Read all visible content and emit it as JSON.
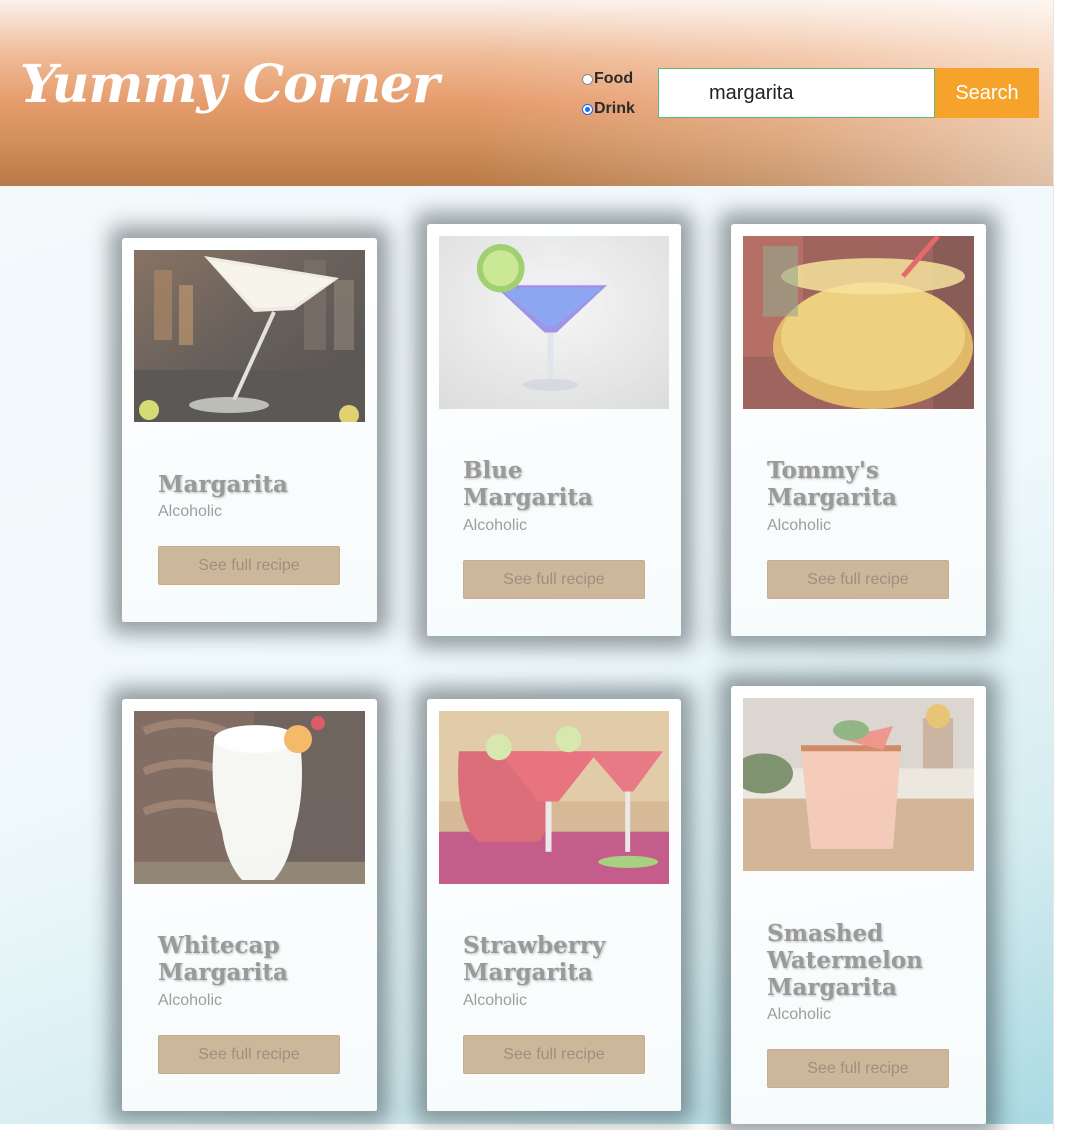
{
  "brand": {
    "logo_text": "Yummy Corner"
  },
  "search": {
    "options": [
      {
        "label": "Food",
        "selected": false
      },
      {
        "label": "Drink",
        "selected": true
      }
    ],
    "query": "margarita",
    "button_label": "Search"
  },
  "colors": {
    "accent": "#f5a32a",
    "card_button": "#cdb79a",
    "header_gradient_top": "#fbf2ec",
    "header_gradient_bottom": "#b87a47"
  },
  "results": [
    {
      "title": "Margarita",
      "category": "Alcoholic",
      "button_label": "See full recipe",
      "image": "margarita-glass-photo"
    },
    {
      "title": "Blue Margarita",
      "category": "Alcoholic",
      "button_label": "See full recipe",
      "image": "blue-margarita-photo"
    },
    {
      "title": "Tommy's Margarita",
      "category": "Alcoholic",
      "button_label": "See full recipe",
      "image": "tommys-margarita-photo"
    },
    {
      "title": "Whitecap Margarita",
      "category": "Alcoholic",
      "button_label": "See full recipe",
      "image": "whitecap-margarita-photo"
    },
    {
      "title": "Strawberry Margarita",
      "category": "Alcoholic",
      "button_label": "See full recipe",
      "image": "strawberry-margarita-photo"
    },
    {
      "title": "Smashed Watermelon Margarita",
      "category": "Alcoholic",
      "button_label": "See full recipe",
      "image": "smashed-watermelon-margarita-photo"
    }
  ]
}
